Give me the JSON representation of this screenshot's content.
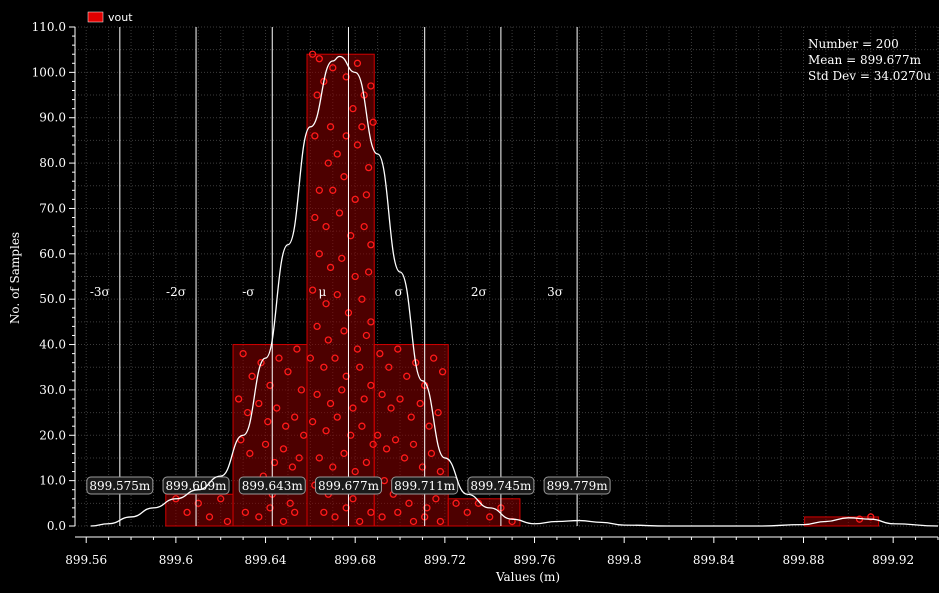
{
  "chart_data": {
    "type": "bar",
    "legend": [
      {
        "name": "vout",
        "color": "#e00000"
      }
    ],
    "legend_placement": "top-left",
    "xlabel": "Values (m)",
    "ylabel": "No. of Samples",
    "xlim": [
      899.555,
      899.94
    ],
    "ylim": [
      0,
      110
    ],
    "x_ticks": [
      "899.56",
      "899.6",
      "899.64",
      "899.68",
      "899.72",
      "899.76",
      "899.8",
      "899.84",
      "899.88",
      "899.92"
    ],
    "x_tick_values": [
      899.56,
      899.6,
      899.64,
      899.68,
      899.72,
      899.76,
      899.8,
      899.84,
      899.88,
      899.92
    ],
    "y_ticks": [
      "0.0",
      "10.0",
      "20.0",
      "30.0",
      "40.0",
      "50.0",
      "60.0",
      "70.0",
      "80.0",
      "90.0",
      "100.0",
      "110.0"
    ],
    "y_tick_values": [
      0,
      10,
      20,
      30,
      40,
      50,
      60,
      70,
      80,
      90,
      100,
      110
    ],
    "grid": true,
    "bins": [
      {
        "x0": 899.5955,
        "x1": 899.6255,
        "count": 7
      },
      {
        "x0": 899.6255,
        "x1": 899.6585,
        "count": 40
      },
      {
        "x0": 899.6585,
        "x1": 899.6885,
        "count": 104
      },
      {
        "x0": 899.6885,
        "x1": 899.7215,
        "count": 40
      },
      {
        "x0": 899.7215,
        "x1": 899.7535,
        "count": 6
      },
      {
        "x0": 899.8805,
        "x1": 899.9135,
        "count": 2
      }
    ],
    "stats": {
      "number": "Number = 200",
      "mean": "Mean = 899.677m",
      "std_dev": "Std Dev = 34.0270u"
    },
    "sigma_lines": [
      {
        "label": "-3σ",
        "value": 899.575,
        "value_label": "899.575m"
      },
      {
        "label": "-2σ",
        "value": 899.609,
        "value_label": "899.609m"
      },
      {
        "label": "-σ",
        "value": 899.643,
        "value_label": "899.643m"
      },
      {
        "label": "μ",
        "value": 899.677,
        "value_label": "899.677m"
      },
      {
        "label": "σ",
        "value": 899.711,
        "value_label": "899.711m"
      },
      {
        "label": "2σ",
        "value": 899.745,
        "value_label": "899.745m"
      },
      {
        "label": "3σ",
        "value": 899.779,
        "value_label": "899.779m"
      }
    ],
    "density_curve": [
      [
        899.562,
        0
      ],
      [
        899.57,
        0.5
      ],
      [
        899.58,
        2
      ],
      [
        899.59,
        4
      ],
      [
        899.6,
        6
      ],
      [
        899.61,
        8
      ],
      [
        899.62,
        11
      ],
      [
        899.63,
        20
      ],
      [
        899.64,
        37
      ],
      [
        899.65,
        62
      ],
      [
        899.66,
        88
      ],
      [
        899.67,
        102.5
      ],
      [
        899.673,
        103.5
      ],
      [
        899.68,
        100
      ],
      [
        899.69,
        82
      ],
      [
        899.7,
        56
      ],
      [
        899.71,
        32
      ],
      [
        899.72,
        15
      ],
      [
        899.73,
        7
      ],
      [
        899.74,
        4
      ],
      [
        899.75,
        1.5
      ],
      [
        899.76,
        0.5
      ],
      [
        899.77,
        1
      ],
      [
        899.78,
        1.2
      ],
      [
        899.79,
        0.8
      ],
      [
        899.8,
        0.2
      ],
      [
        899.82,
        0
      ],
      [
        899.86,
        0
      ],
      [
        899.88,
        0.3
      ],
      [
        899.89,
        1
      ],
      [
        899.9,
        1.8
      ],
      [
        899.91,
        1.5
      ],
      [
        899.92,
        0.5
      ],
      [
        899.94,
        0
      ]
    ],
    "sample_points": [
      [
        899.661,
        104
      ],
      [
        899.664,
        103
      ],
      [
        899.666,
        98
      ],
      [
        899.663,
        95
      ],
      [
        899.67,
        101
      ],
      [
        899.676,
        99
      ],
      [
        899.681,
        102
      ],
      [
        899.684,
        95
      ],
      [
        899.687,
        97
      ],
      [
        899.679,
        92
      ],
      [
        899.683,
        88
      ],
      [
        899.688,
        89
      ],
      [
        899.669,
        88
      ],
      [
        899.662,
        86
      ],
      [
        899.668,
        80
      ],
      [
        899.672,
        82
      ],
      [
        899.676,
        86
      ],
      [
        899.681,
        84
      ],
      [
        899.686,
        79
      ],
      [
        899.664,
        74
      ],
      [
        899.67,
        74
      ],
      [
        899.675,
        77
      ],
      [
        899.68,
        72
      ],
      [
        899.685,
        73
      ],
      [
        899.662,
        68
      ],
      [
        899.667,
        66
      ],
      [
        899.673,
        69
      ],
      [
        899.678,
        64
      ],
      [
        899.684,
        66
      ],
      [
        899.687,
        62
      ],
      [
        899.664,
        60
      ],
      [
        899.669,
        57
      ],
      [
        899.674,
        59
      ],
      [
        899.68,
        55
      ],
      [
        899.686,
        56
      ],
      [
        899.661,
        52
      ],
      [
        899.667,
        49
      ],
      [
        899.672,
        51
      ],
      [
        899.677,
        47
      ],
      [
        899.683,
        50
      ],
      [
        899.687,
        45
      ],
      [
        899.663,
        44
      ],
      [
        899.668,
        41
      ],
      [
        899.675,
        43
      ],
      [
        899.681,
        39
      ],
      [
        899.685,
        42
      ],
      [
        899.66,
        37
      ],
      [
        899.666,
        35
      ],
      [
        899.671,
        37
      ],
      [
        899.676,
        33
      ],
      [
        899.682,
        35
      ],
      [
        899.687,
        31
      ],
      [
        899.663,
        29
      ],
      [
        899.669,
        27
      ],
      [
        899.674,
        30
      ],
      [
        899.679,
        26
      ],
      [
        899.684,
        28
      ],
      [
        899.661,
        23
      ],
      [
        899.667,
        21
      ],
      [
        899.672,
        24
      ],
      [
        899.678,
        20
      ],
      [
        899.683,
        22
      ],
      [
        899.688,
        18
      ],
      [
        899.664,
        15
      ],
      [
        899.67,
        13
      ],
      [
        899.675,
        16
      ],
      [
        899.68,
        12
      ],
      [
        899.685,
        14
      ],
      [
        899.662,
        9
      ],
      [
        899.668,
        7
      ],
      [
        899.673,
        10
      ],
      [
        899.679,
        6
      ],
      [
        899.684,
        8
      ],
      [
        899.666,
        3
      ],
      [
        899.671,
        2
      ],
      [
        899.676,
        4
      ],
      [
        899.682,
        1
      ],
      [
        899.687,
        3
      ],
      [
        899.63,
        38
      ],
      [
        899.634,
        33
      ],
      [
        899.638,
        36
      ],
      [
        899.642,
        31
      ],
      [
        899.646,
        37
      ],
      [
        899.65,
        34
      ],
      [
        899.654,
        39
      ],
      [
        899.656,
        30
      ],
      [
        899.628,
        28
      ],
      [
        899.632,
        25
      ],
      [
        899.637,
        27
      ],
      [
        899.641,
        23
      ],
      [
        899.645,
        26
      ],
      [
        899.649,
        22
      ],
      [
        899.653,
        24
      ],
      [
        899.657,
        20
      ],
      [
        899.629,
        19
      ],
      [
        899.633,
        16
      ],
      [
        899.64,
        18
      ],
      [
        899.644,
        14
      ],
      [
        899.648,
        17
      ],
      [
        899.652,
        13
      ],
      [
        899.655,
        15
      ],
      [
        899.63,
        10
      ],
      [
        899.636,
        8
      ],
      [
        899.639,
        11
      ],
      [
        899.643,
        7
      ],
      [
        899.647,
        9
      ],
      [
        899.651,
        5
      ],
      [
        899.655,
        8
      ],
      [
        899.631,
        3
      ],
      [
        899.637,
        2
      ],
      [
        899.642,
        4
      ],
      [
        899.648,
        1
      ],
      [
        899.653,
        3
      ],
      [
        899.691,
        38
      ],
      [
        899.695,
        35
      ],
      [
        899.699,
        39
      ],
      [
        899.703,
        33
      ],
      [
        899.707,
        36
      ],
      [
        899.711,
        31
      ],
      [
        899.715,
        37
      ],
      [
        899.719,
        34
      ],
      [
        899.692,
        29
      ],
      [
        899.696,
        26
      ],
      [
        899.7,
        28
      ],
      [
        899.705,
        24
      ],
      [
        899.709,
        27
      ],
      [
        899.713,
        22
      ],
      [
        899.717,
        25
      ],
      [
        899.69,
        20
      ],
      [
        899.694,
        17
      ],
      [
        899.698,
        19
      ],
      [
        899.702,
        15
      ],
      [
        899.706,
        18
      ],
      [
        899.71,
        13
      ],
      [
        899.714,
        16
      ],
      [
        899.718,
        12
      ],
      [
        899.693,
        10
      ],
      [
        899.697,
        7
      ],
      [
        899.701,
        9
      ],
      [
        899.704,
        5
      ],
      [
        899.708,
        8
      ],
      [
        899.712,
        4
      ],
      [
        899.716,
        6
      ],
      [
        899.692,
        2
      ],
      [
        899.699,
        3
      ],
      [
        899.706,
        1
      ],
      [
        899.711,
        2
      ],
      [
        899.718,
        1
      ],
      [
        899.6,
        6
      ],
      [
        899.605,
        3
      ],
      [
        899.61,
        5
      ],
      [
        899.615,
        2
      ],
      [
        899.62,
        6
      ],
      [
        899.623,
        1
      ],
      [
        899.725,
        5
      ],
      [
        899.73,
        3
      ],
      [
        899.735,
        5
      ],
      [
        899.74,
        2
      ],
      [
        899.745,
        4
      ],
      [
        899.75,
        1
      ],
      [
        899.905,
        1.5
      ],
      [
        899.91,
        2
      ]
    ]
  }
}
